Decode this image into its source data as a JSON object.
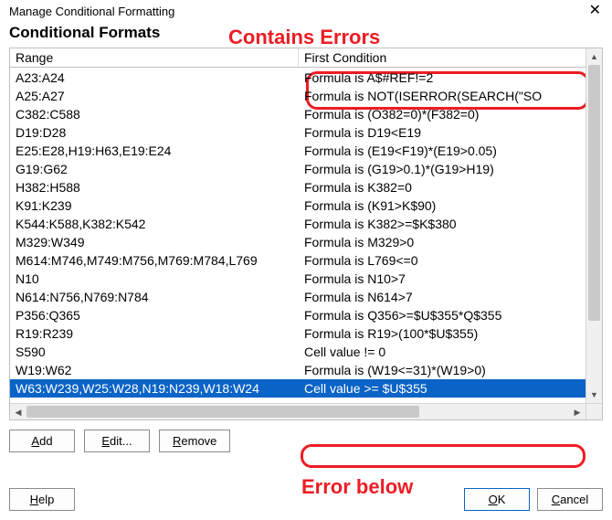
{
  "window": {
    "title": "Manage Conditional Formatting",
    "close_glyph": "✕"
  },
  "annotations": {
    "contains_errors": "Contains Errors",
    "error_below": "Error below"
  },
  "section_title": "Conditional Formats",
  "columns": {
    "range": "Range",
    "first_condition": "First Condition"
  },
  "rows": [
    {
      "range": "A23:A24",
      "cond": "Formula is A$#REF!=2",
      "selected": false
    },
    {
      "range": "A25:A27",
      "cond": "Formula is NOT(ISERROR(SEARCH(\"SO",
      "selected": false
    },
    {
      "range": "C382:C588",
      "cond": "Formula is (O382=0)*(F382=0)",
      "selected": false
    },
    {
      "range": "D19:D28",
      "cond": "Formula is D19<E19",
      "selected": false
    },
    {
      "range": "E25:E28,H19:H63,E19:E24",
      "cond": "Formula is (E19<F19)*(E19>0.05)",
      "selected": false
    },
    {
      "range": "G19:G62",
      "cond": "Formula is (G19>0.1)*(G19>H19)",
      "selected": false
    },
    {
      "range": "H382:H588",
      "cond": "Formula is K382=0",
      "selected": false
    },
    {
      "range": "K91:K239",
      "cond": "Formula is (K91>K$90)",
      "selected": false
    },
    {
      "range": "K544:K588,K382:K542",
      "cond": "Formula is K382>=$K$380",
      "selected": false
    },
    {
      "range": "M329:W349",
      "cond": "Formula is M329>0",
      "selected": false
    },
    {
      "range": "M614:M746,M749:M756,M769:M784,L769",
      "cond": "Formula is L769<=0",
      "selected": false
    },
    {
      "range": "N10",
      "cond": "Formula is N10>7",
      "selected": false
    },
    {
      "range": "N614:N756,N769:N784",
      "cond": "Formula is N614>7",
      "selected": false
    },
    {
      "range": "P356:Q365",
      "cond": "Formula is Q356>=$U$355*Q$355",
      "selected": false
    },
    {
      "range": "R19:R239",
      "cond": "Formula is R19>(100*$U$355)",
      "selected": false
    },
    {
      "range": "S590",
      "cond": "Cell value != 0",
      "selected": false
    },
    {
      "range": "W19:W62",
      "cond": "Formula is (W19<=31)*(W19>0)",
      "selected": false
    },
    {
      "range": "W63:W239,W25:W28,N19:N239,W18:W24",
      "cond": "Cell value >= $U$355",
      "selected": true
    }
  ],
  "buttons": {
    "add_pre": "",
    "add_u": "A",
    "add_post": "dd",
    "edit_pre": "",
    "edit_u": "E",
    "edit_post": "dit...",
    "remove_pre": "",
    "remove_u": "R",
    "remove_post": "emove",
    "help_pre": "",
    "help_u": "H",
    "help_post": "elp",
    "ok_pre": "",
    "ok_u": "O",
    "ok_post": "K",
    "cancel_pre": "",
    "cancel_u": "C",
    "cancel_post": "ancel"
  },
  "scroll": {
    "up": "▲",
    "down": "▼",
    "left": "◀",
    "right": "▶"
  }
}
